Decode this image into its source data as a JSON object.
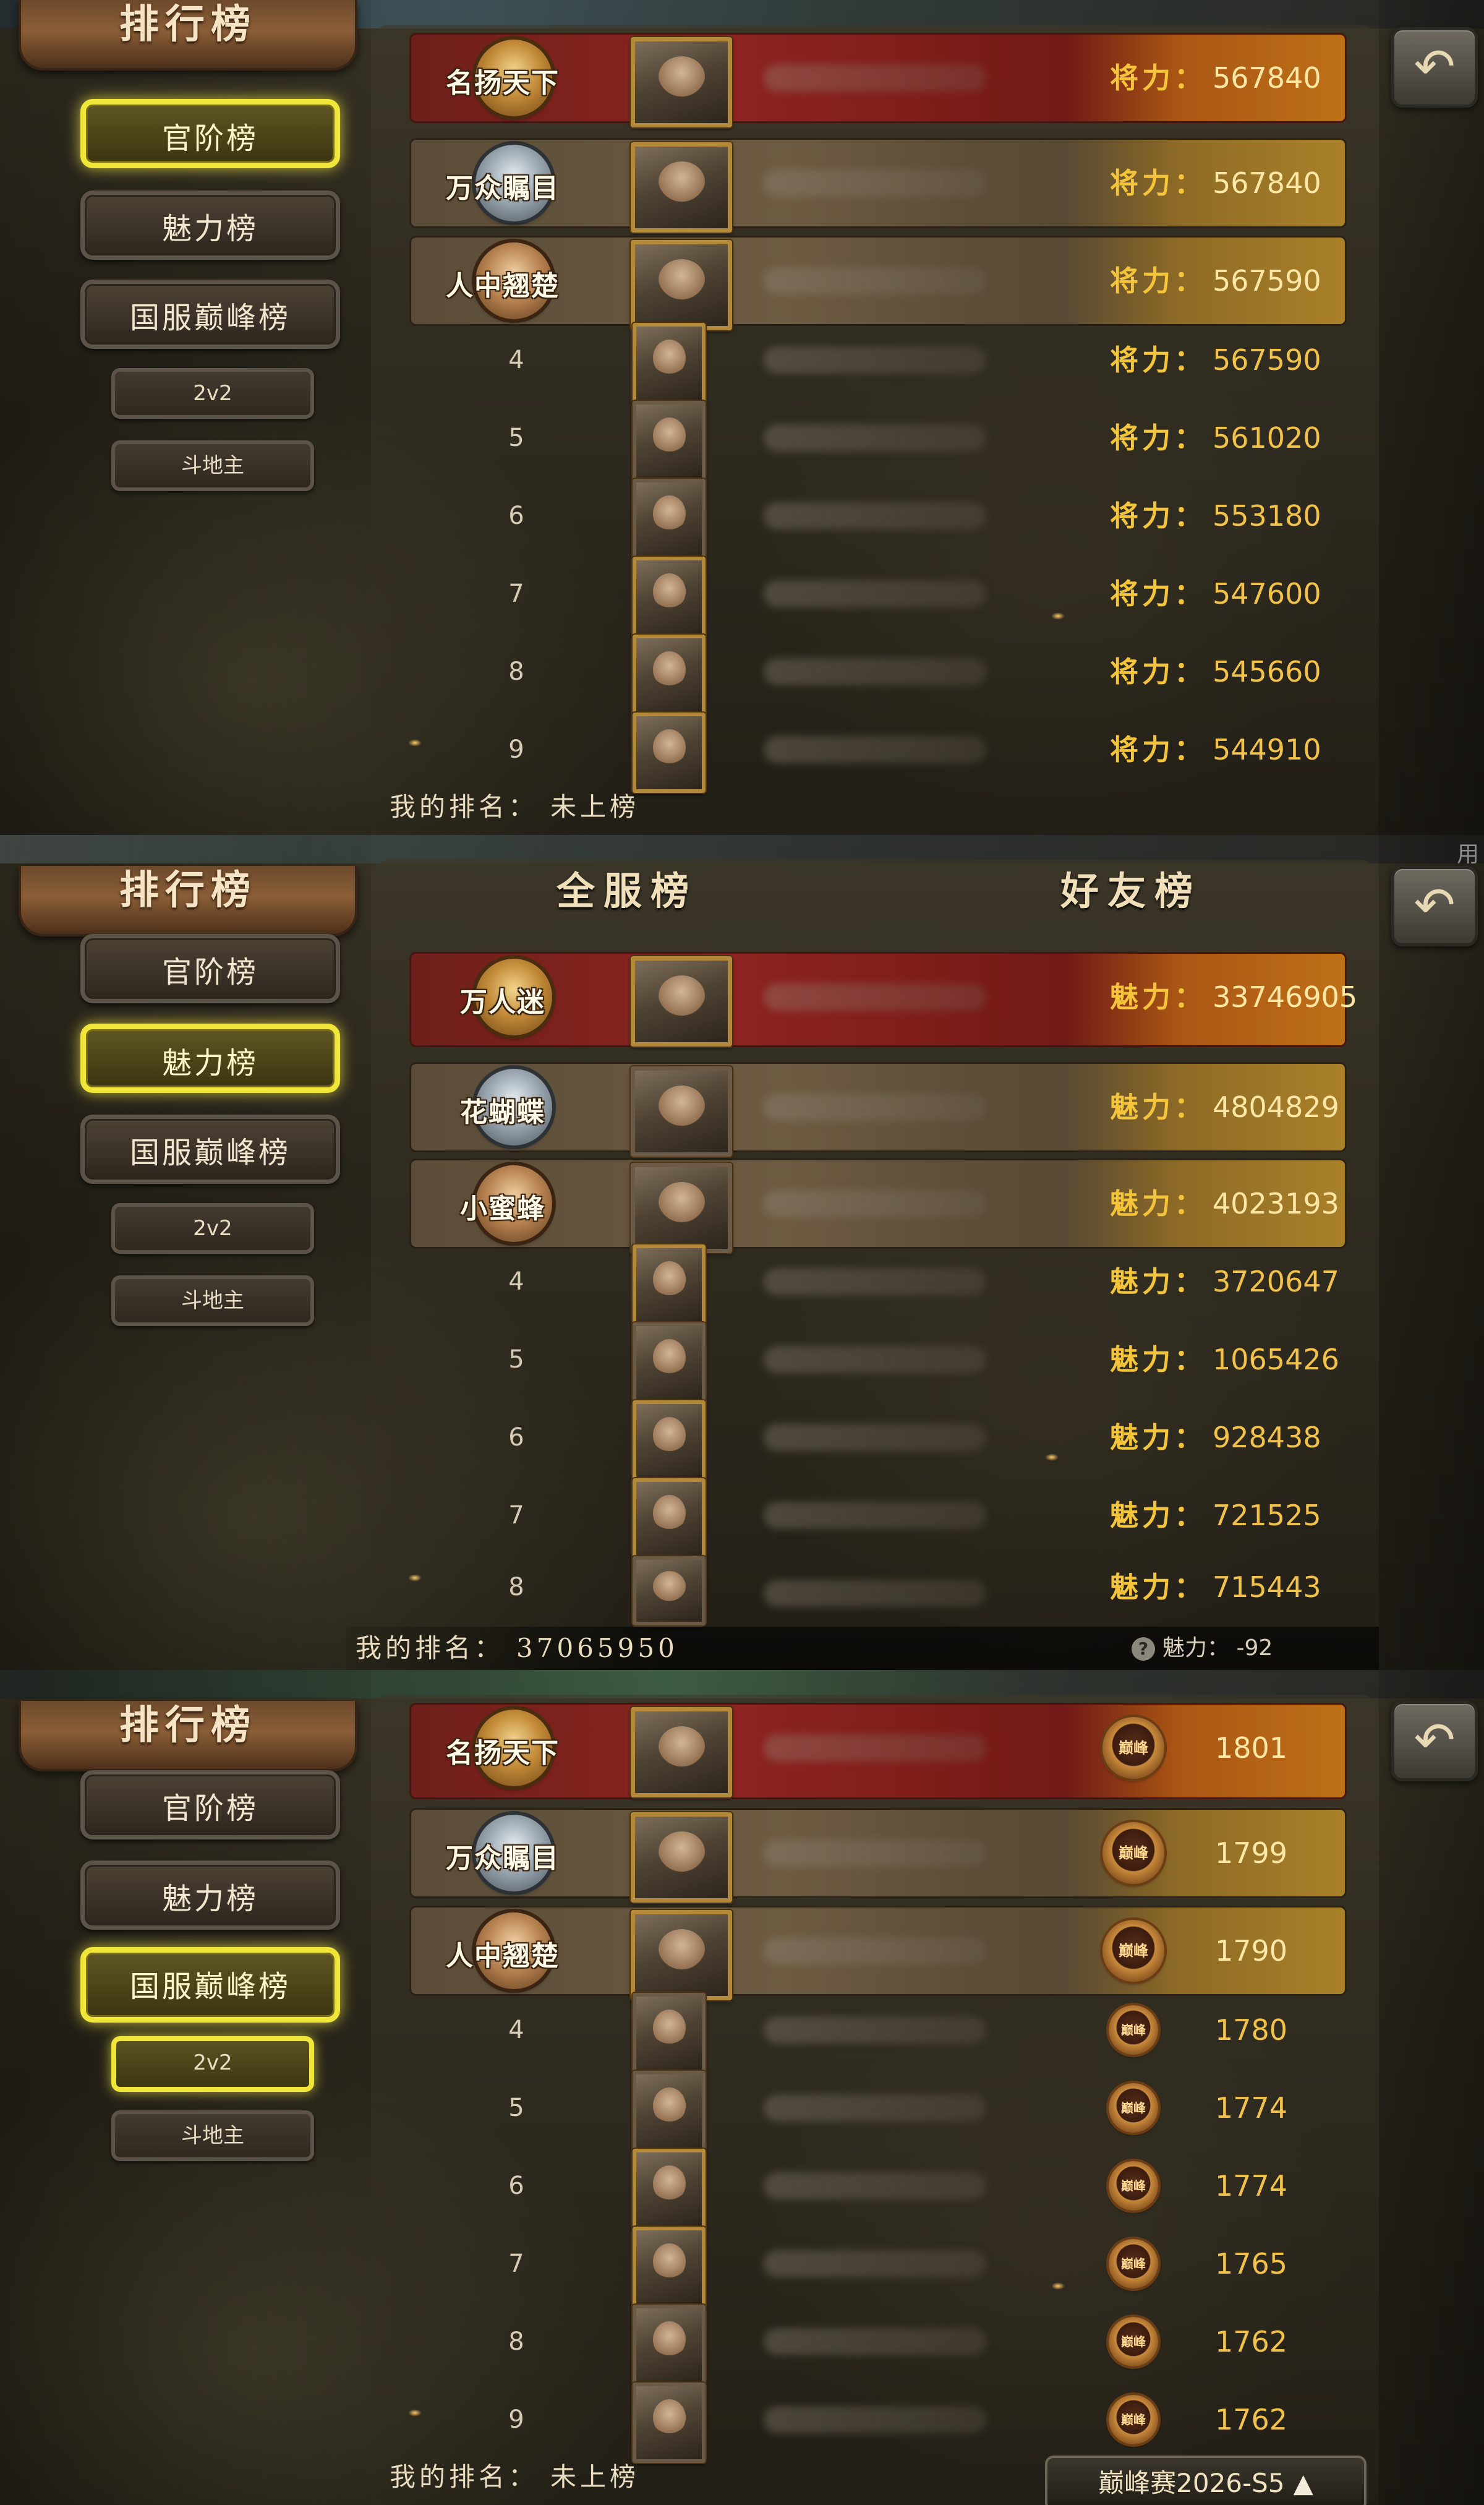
{
  "title": "排行榜",
  "tabs": [
    "官阶榜",
    "魅力榜",
    "国服巅峰榜"
  ],
  "subtabs": [
    "2v2",
    "斗地主"
  ],
  "corner_text": "用",
  "panel1": {
    "stat_label": "将力：",
    "rows": [
      {
        "rank": "1",
        "title": "名扬天下",
        "value": "567840"
      },
      {
        "rank": "2",
        "title": "万众瞩目",
        "value": "567840"
      },
      {
        "rank": "3",
        "title": "人中翘楚",
        "value": "567590"
      },
      {
        "rank": "4",
        "value": "567590"
      },
      {
        "rank": "5",
        "value": "561020"
      },
      {
        "rank": "6",
        "value": "553180"
      },
      {
        "rank": "7",
        "value": "547600"
      },
      {
        "rank": "8",
        "value": "545660"
      },
      {
        "rank": "9",
        "value": "544910"
      }
    ],
    "my_rank_label": "我的排名：",
    "my_rank_value": "未上榜"
  },
  "panel2": {
    "header_left": "全服榜",
    "header_right": "好友榜",
    "stat_label": "魅力：",
    "rows": [
      {
        "rank": "1",
        "title": "万人迷",
        "value": "33746905"
      },
      {
        "rank": "2",
        "title": "花蝴蝶",
        "value": "4804829"
      },
      {
        "rank": "3",
        "title": "小蜜蜂",
        "value": "4023193"
      },
      {
        "rank": "4",
        "value": "3720647"
      },
      {
        "rank": "5",
        "value": "1065426"
      },
      {
        "rank": "6",
        "value": "928438"
      },
      {
        "rank": "7",
        "value": "721525"
      },
      {
        "rank": "8",
        "value": "715443"
      }
    ],
    "my_rank_label": "我的排名：",
    "my_rank_value": "37065950",
    "charm_label": "魅力：",
    "charm_value": "-92",
    "help_glyph": "?"
  },
  "panel3": {
    "peak_badge": "巅峰",
    "rows": [
      {
        "rank": "1",
        "title": "名扬天下",
        "value": "1801"
      },
      {
        "rank": "2",
        "title": "万众瞩目",
        "value": "1799"
      },
      {
        "rank": "3",
        "title": "人中翘楚",
        "value": "1790"
      },
      {
        "rank": "4",
        "value": "1780"
      },
      {
        "rank": "5",
        "value": "1774"
      },
      {
        "rank": "6",
        "value": "1774"
      },
      {
        "rank": "7",
        "value": "1765"
      },
      {
        "rank": "8",
        "value": "1762"
      },
      {
        "rank": "9",
        "value": "1762"
      }
    ],
    "my_rank_label": "我的排名：",
    "my_rank_value": "未上榜",
    "season_label": "巅峰赛2026-S5",
    "season_arrow": "▲"
  },
  "icons": {
    "back": "back-arrow-icon",
    "help": "help-icon"
  },
  "colors": {
    "active_tab_border": "#f0e63a",
    "stat_label": "#f4c53a",
    "top1_row": "#8d2421",
    "top_rows": "#6d5c42"
  }
}
